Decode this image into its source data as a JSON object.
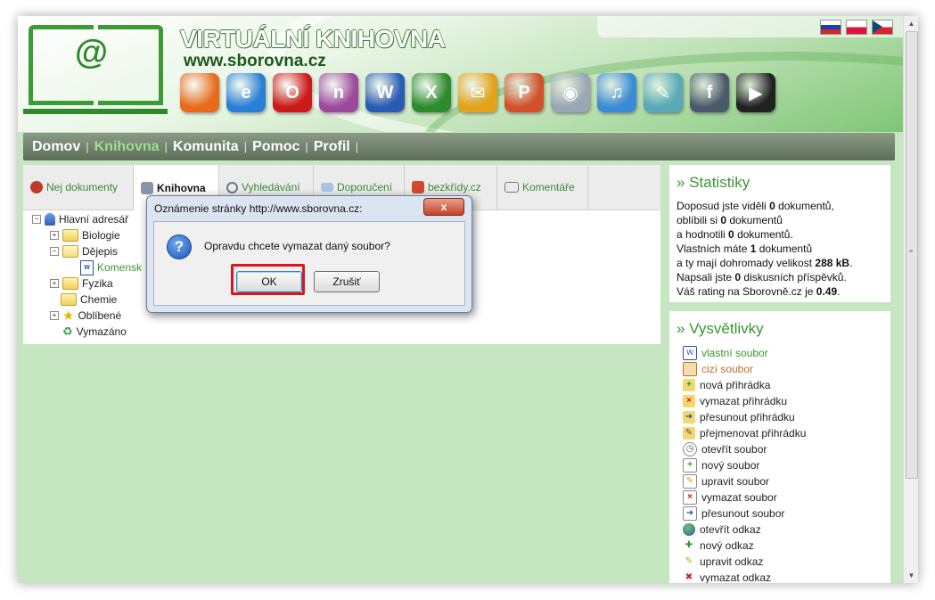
{
  "header": {
    "site_title": "VIRTUÁLNÍ KNIHOVNA",
    "site_url": "www.sborovna.cz",
    "app_icons": [
      {
        "name": "firefox-icon",
        "glyph": "",
        "color": "#e76b1c"
      },
      {
        "name": "internet-explorer-icon",
        "glyph": "e",
        "color": "#2a7fd4"
      },
      {
        "name": "opera-icon",
        "glyph": "O",
        "color": "#cc1a1a"
      },
      {
        "name": "onenote-icon",
        "glyph": "n",
        "color": "#9b4a9b"
      },
      {
        "name": "word-icon",
        "glyph": "W",
        "color": "#2a5bb4"
      },
      {
        "name": "excel-icon",
        "glyph": "X",
        "color": "#2e8a2e"
      },
      {
        "name": "outlook-icon",
        "glyph": "✉",
        "color": "#e3a21a"
      },
      {
        "name": "powerpoint-icon",
        "glyph": "P",
        "color": "#d2502a"
      },
      {
        "name": "cd-icon",
        "glyph": "◉",
        "color": "#9aa6b4"
      },
      {
        "name": "itunes-icon",
        "glyph": "♫",
        "color": "#3a8ad6"
      },
      {
        "name": "feather-icon",
        "glyph": "✎",
        "color": "#5aa8b8"
      },
      {
        "name": "flash-icon",
        "glyph": "f",
        "color": "#4a5a6a"
      },
      {
        "name": "avi-video-icon",
        "glyph": "▶",
        "color": "#222222"
      }
    ],
    "flags": [
      "sk",
      "pl",
      "cz"
    ]
  },
  "menu": {
    "items": [
      "Domov",
      "Knihovna",
      "Komunita",
      "Pomoc",
      "Profil"
    ],
    "active": "Knihovna",
    "separator": "|"
  },
  "tabs": [
    {
      "label": "Nej dokumenty",
      "icon": "award-icon",
      "active": false
    },
    {
      "label": "Knihovna",
      "icon": "library-icon",
      "active": true
    },
    {
      "label": "Vyhledávání",
      "icon": "magnifier-icon",
      "active": false
    },
    {
      "label": "Doporučení",
      "icon": "envelope-icon",
      "active": false
    },
    {
      "label": "bezkřídy.cz",
      "icon": "home-icon",
      "active": false
    },
    {
      "label": "Komentáře",
      "icon": "comments-icon",
      "active": false
    }
  ],
  "tree": {
    "root": "Hlavní adresář",
    "items": [
      "Biologie",
      "Dějepis",
      "Komensk",
      "Fyzika",
      "Chemie",
      "Oblíbené",
      "Vymazáno"
    ]
  },
  "stats": {
    "title": "» Statistiky",
    "l1a": "Doposud jste viděli ",
    "l1b": "0",
    "l1c": " dokumentů,",
    "l2a": "oblíbili si ",
    "l2b": "0",
    "l2c": " dokumentů",
    "l3a": "a hodnotili ",
    "l3b": "0",
    "l3c": " dokumentů.",
    "l4a": "Vlastních máte ",
    "l4b": "1",
    "l4c": " dokumentů",
    "l5a": "a ty mají dohromady velikost ",
    "l5b": "288 kB",
    "l5c": ".",
    "l6a": "Napsali jste ",
    "l6b": "0",
    "l6c": " diskusních příspěvků.",
    "l7a": "Váš rating na Sborovně.cz je ",
    "l7b": "0.49",
    "l7c": "."
  },
  "legend": {
    "title": "» Vysvětlivky",
    "items": [
      "vlastní soubor",
      "cizí soubor",
      "nová přihrádka",
      "vymazat přihrádku",
      "přesunout přihrádku",
      "přejmenovat přihrádku",
      "otevřít soubor",
      "nový soubor",
      "upravit soubor",
      "vymazat soubor",
      "přesunout soubor",
      "otevřít odkaz",
      "nový odkaz",
      "upravit odkaz",
      "vymazat odkaz"
    ]
  },
  "dialog": {
    "title": "Oznámenie stránky http://www.sborovna.cz:",
    "close": "x",
    "message": "Opravdu chcete vymazat daný soubor?",
    "ok": "OK",
    "cancel": "Zrušiť"
  }
}
